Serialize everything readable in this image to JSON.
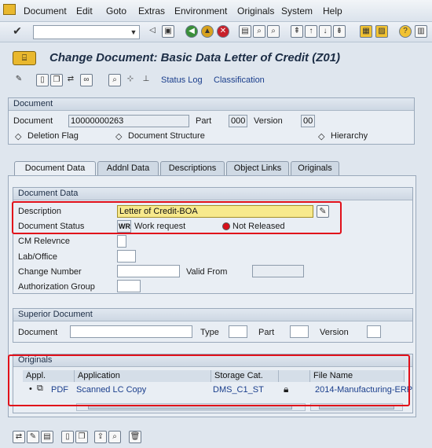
{
  "menu": {
    "items": [
      "Document",
      "Edit",
      "Goto",
      "Extras",
      "Environment",
      "Originals",
      "System",
      "Help"
    ]
  },
  "toolbar": {
    "command_value": ""
  },
  "title": {
    "text": "Change Document: Basic Data Letter of Credit (Z01)"
  },
  "app_toolbar": {
    "status_log": "Status Log",
    "classification": "Classification"
  },
  "document_group": {
    "header": "Document",
    "document_label": "Document",
    "document_value": "10000000263",
    "part_label": "Part",
    "part_value": "000",
    "version_label": "Version",
    "version_value": "00",
    "deletion_flag": "Deletion Flag",
    "document_structure": "Document Structure",
    "hierarchy": "Hierarchy"
  },
  "tabs": [
    "Document Data",
    "Addnl Data",
    "Descriptions",
    "Object Links",
    "Originals"
  ],
  "document_data": {
    "header": "Document Data",
    "description_label": "Description",
    "description_value": "Letter of Credit-BOA",
    "status_label": "Document Status",
    "status_code": "WR",
    "status_text": "Work request",
    "release_text": "Not Released",
    "cm_relevance_label": "CM Relevnce",
    "lab_office_label": "Lab/Office",
    "change_number_label": "Change Number",
    "valid_from_label": "Valid From",
    "authorization_group_label": "Authorization Group"
  },
  "superior": {
    "header": "Superior Document",
    "document_label": "Document",
    "type_label": "Type",
    "part_label": "Part",
    "version_label": "Version"
  },
  "originals": {
    "header": "Originals",
    "columns": [
      "Appl.",
      "Application",
      "Storage Cat.",
      "",
      "File Name"
    ],
    "rows": [
      {
        "appl": "PDF",
        "application": "Scanned LC Copy",
        "storage": "DMS_C1_ST",
        "file": "2014-Manufacturing-ERP"
      }
    ]
  },
  "colors": {
    "highlight_border": "#e1101a",
    "field_highlight": "#f7e98c",
    "link": "#1a3e8c"
  }
}
